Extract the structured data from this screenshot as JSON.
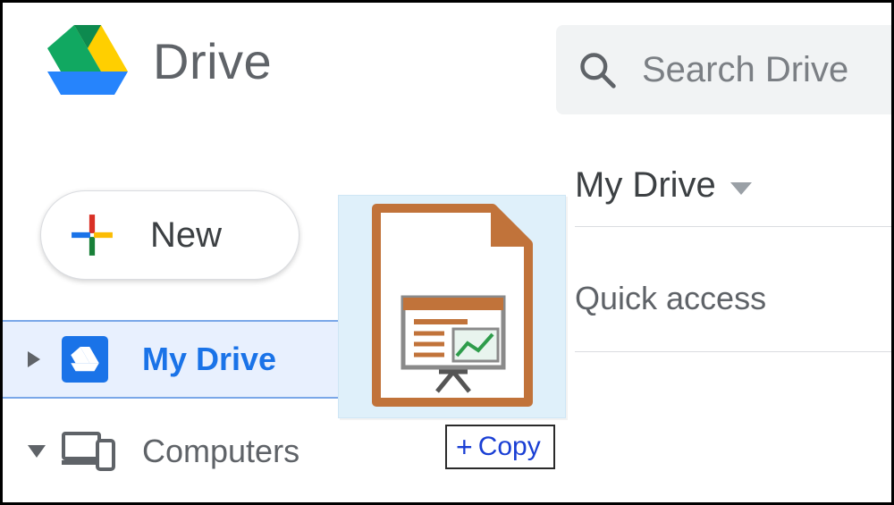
{
  "brand": {
    "title": "Drive"
  },
  "search": {
    "placeholder": "Search Drive"
  },
  "sidebar": {
    "new_label": "New",
    "items": [
      {
        "label": "My Drive"
      },
      {
        "label": "Computers"
      }
    ]
  },
  "main": {
    "breadcrumb": "My Drive",
    "quick_access_label": "Quick access"
  },
  "drag": {
    "tooltip_label": "Copy",
    "file_kind": "presentation"
  }
}
